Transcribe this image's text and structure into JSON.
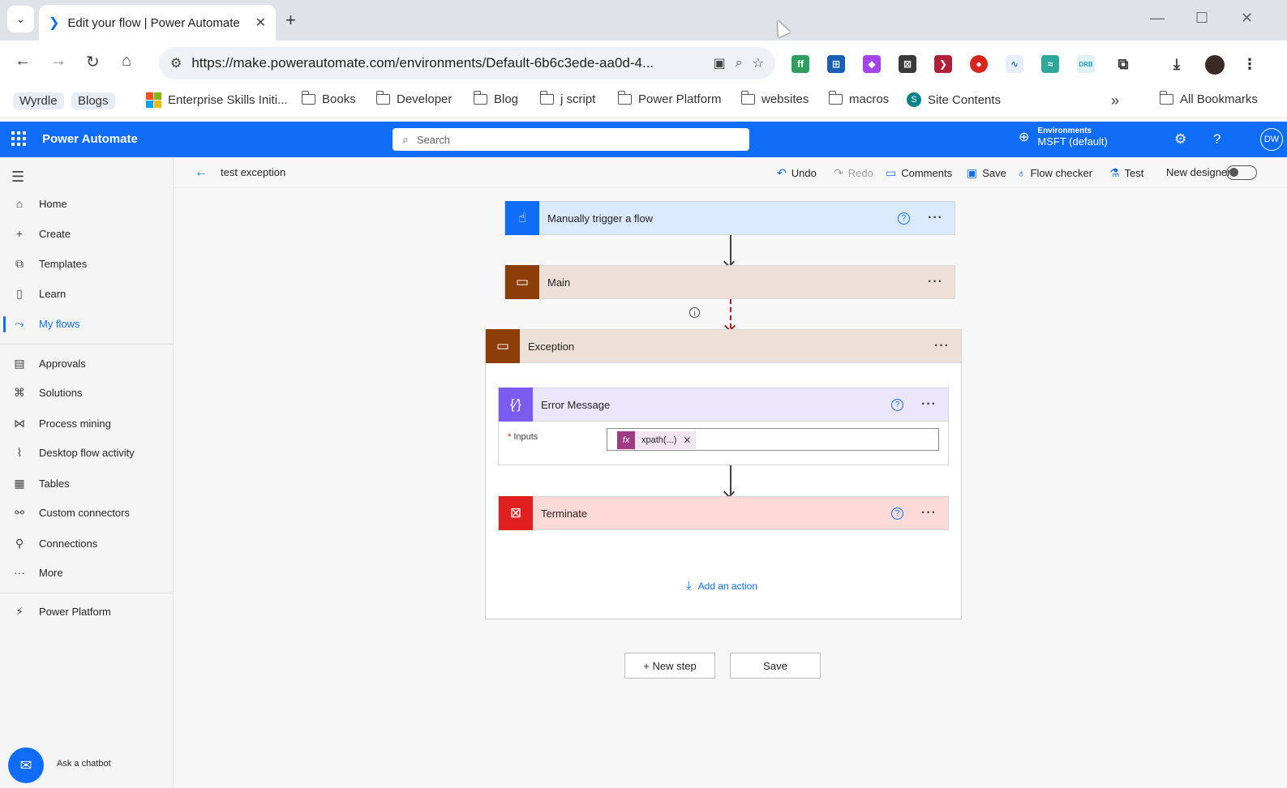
{
  "browser": {
    "tab_title": "Edit your flow | Power Automate",
    "url": "https://make.powerautomate.com/environments/Default-6b6c3ede-aa0d-4...",
    "bookmarks": [
      {
        "label": "Wyrdle",
        "type": "chip"
      },
      {
        "label": "Blogs",
        "type": "chip"
      },
      {
        "label": "Enterprise Skills Initi...",
        "type": "ms"
      },
      {
        "label": "Books",
        "type": "folder"
      },
      {
        "label": "Developer",
        "type": "folder"
      },
      {
        "label": "Blog",
        "type": "folder"
      },
      {
        "label": "j script",
        "type": "folder"
      },
      {
        "label": "Power Platform",
        "type": "folder"
      },
      {
        "label": "websites",
        "type": "folder"
      },
      {
        "label": "macros",
        "type": "folder"
      },
      {
        "label": "Site Contents",
        "type": "sharepoint"
      }
    ],
    "all_bookmarks": "All Bookmarks"
  },
  "app": {
    "name": "Power Automate",
    "search_placeholder": "Search",
    "environment_label": "Environments",
    "environment_value": "MSFT (default)",
    "avatar_initials": "DW"
  },
  "sidebar": {
    "items": [
      {
        "label": "Home",
        "icon": "home-icon"
      },
      {
        "label": "Create",
        "icon": "plus-icon"
      },
      {
        "label": "Templates",
        "icon": "templates-icon"
      },
      {
        "label": "Learn",
        "icon": "book-icon"
      },
      {
        "label": "My flows",
        "icon": "flows-icon",
        "active": true
      },
      {
        "label": "Approvals",
        "icon": "approvals-icon"
      },
      {
        "label": "Solutions",
        "icon": "solutions-icon"
      },
      {
        "label": "Process mining",
        "icon": "process-mining-icon"
      },
      {
        "label": "Desktop flow activity",
        "icon": "activity-icon"
      },
      {
        "label": "Tables",
        "icon": "table-icon"
      },
      {
        "label": "Custom connectors",
        "icon": "connector-icon"
      },
      {
        "label": "Connections",
        "icon": "plug-icon"
      },
      {
        "label": "More",
        "icon": "more-icon"
      },
      {
        "label": "Power Platform",
        "icon": "power-platform-icon"
      }
    ],
    "chatbot_label": "Ask a chatbot"
  },
  "commandbar": {
    "flow_name": "test exception",
    "undo": "Undo",
    "redo": "Redo",
    "comments": "Comments",
    "save": "Save",
    "flow_checker": "Flow checker",
    "test": "Test",
    "new_designer": "New designer"
  },
  "flow": {
    "trigger": {
      "title": "Manually trigger a flow",
      "color": "#0f6cf6",
      "bg": "#dbe9fd"
    },
    "main": {
      "title": "Main",
      "color": "#8c3d08",
      "bg": "#ede0d8"
    },
    "exception": {
      "title": "Exception",
      "color": "#8c3d08",
      "bg": "#ede0d8"
    },
    "error_message": {
      "title": "Error Message",
      "color": "#7b5cf0",
      "bg": "#ece6fd",
      "field_label": "Inputs",
      "token": "xpath(...)"
    },
    "terminate": {
      "title": "Terminate",
      "color": "#e02020",
      "bg": "#fbdad8"
    },
    "add_action": "Add an action",
    "new_step": "+ New step",
    "save": "Save"
  }
}
